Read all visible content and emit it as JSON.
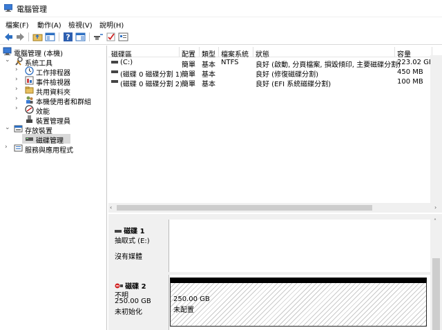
{
  "window": {
    "title": "電腦管理"
  },
  "menu": {
    "items": [
      "檔案(F)",
      "動作(A)",
      "檢視(V)",
      "說明(H)"
    ]
  },
  "toolbar": {
    "icons": [
      "back-icon",
      "forward-icon",
      "up-folder-icon",
      "show-tree-icon",
      "help-icon",
      "properties-icon",
      "connect-icon",
      "check-icon",
      "console-icon"
    ]
  },
  "tree": {
    "root": "電腦管理 (本機)",
    "system_tools": "系統工具",
    "task_scheduler": "工作排程器",
    "event_viewer": "事件檢視器",
    "shared_folders": "共用資料夾",
    "local_users": "本機使用者和群組",
    "performance": "效能",
    "device_manager": "裝置管理員",
    "storage": "存放裝置",
    "disk_management": "磁碟管理",
    "services": "服務與應用程式"
  },
  "volumes": {
    "columns": [
      "磁碟區",
      "配置",
      "類型",
      "檔案系統",
      "狀態",
      "容量"
    ],
    "rows": [
      {
        "name": "(C:)",
        "layout": "簡單",
        "type": "基本",
        "fs": "NTFS",
        "status": "良好 (啟動, 分頁檔案, 損毀傾印, 主要磁碟分割)",
        "capacity": "223.02 GB"
      },
      {
        "name": "(磁碟 0 磁碟分割 1)",
        "layout": "簡單",
        "type": "基本",
        "fs": "",
        "status": "良好 (修復磁碟分割)",
        "capacity": "450 MB"
      },
      {
        "name": "(磁碟 0 磁碟分割 2)",
        "layout": "簡單",
        "type": "基本",
        "fs": "",
        "status": "良好 (EFI 系統磁碟分割)",
        "capacity": "100 MB"
      }
    ]
  },
  "disks": [
    {
      "name": "磁碟 1",
      "kind": "抽取式 (E:)",
      "info": "沒有媒體",
      "extra": ""
    },
    {
      "name": "磁碟 2",
      "kind": "不明",
      "info": "250.00 GB",
      "extra": "未初始化",
      "unalloc_size": "250.00 GB",
      "unalloc_label": "未配置"
    }
  ]
}
